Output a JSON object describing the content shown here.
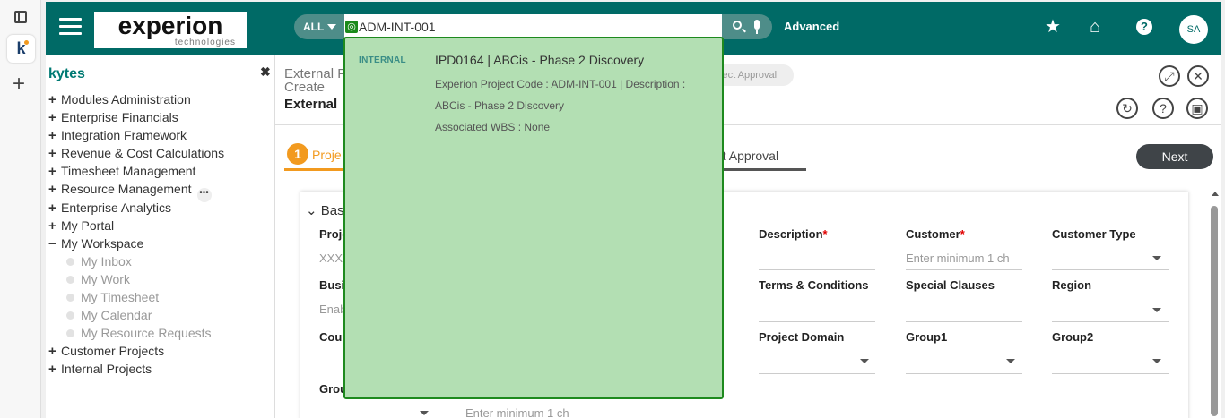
{
  "header": {
    "logo_main": "experion",
    "logo_sub": "technologies",
    "search_scope": "ALL",
    "search_value": "ADM-INT-001",
    "advanced_label": "Advanced",
    "help_glyph": "?",
    "avatar_initials": "SA"
  },
  "sidebar": {
    "title": "kytes",
    "items": [
      {
        "label": "Modules Administration",
        "state": "+"
      },
      {
        "label": "Enterprise Financials",
        "state": "+"
      },
      {
        "label": "Integration Framework",
        "state": "+"
      },
      {
        "label": "Revenue & Cost Calculations",
        "state": "+"
      },
      {
        "label": "Timesheet Management",
        "state": "+"
      },
      {
        "label": "Resource Management",
        "state": "+"
      },
      {
        "label": "Enterprise Analytics",
        "state": "+"
      },
      {
        "label": "My Portal",
        "state": "+"
      },
      {
        "label": "My Workspace",
        "state": "−"
      },
      {
        "label": "Customer Projects",
        "state": "+"
      },
      {
        "label": "Internal Projects",
        "state": "+"
      }
    ],
    "workspace_sub": [
      "My Inbox",
      "My Work",
      "My Timesheet",
      "My Calendar",
      "My Resource Requests"
    ]
  },
  "main": {
    "breadcrumb_line1": "External P",
    "breadcrumb_line2": "Create",
    "chip_text": "oject Approval",
    "page_title": "External",
    "step_number": "1",
    "tab1_label": "Proje",
    "tab_approval": "ect Approval",
    "next_label": "Next",
    "section_label": "Basi",
    "fields": {
      "proj_label": "Proje",
      "proj_value": "XXX",
      "busi_label": "Busi",
      "busi_value": "Enab",
      "cour_label": "Cour",
      "grou_label": "Grou",
      "grou_value": "Enter minimum 1 ch",
      "description": "Description",
      "customer": "Customer",
      "customer_placeholder": "Enter minimum 1 ch",
      "customer_type": "Customer Type",
      "terms": "Terms & Conditions",
      "special": "Special Clauses",
      "region": "Region",
      "project_domain": "Project Domain",
      "group1": "Group1",
      "group2": "Group2"
    }
  },
  "dropdown": {
    "tag": "INTERNAL",
    "title": "IPD0164 | ABCis - Phase 2 Discovery",
    "line1": "Experion Project Code : ADM-INT-001 | Description :",
    "line2": "ABCis - Phase 2 Discovery",
    "line3": "Associated WBS : None"
  }
}
